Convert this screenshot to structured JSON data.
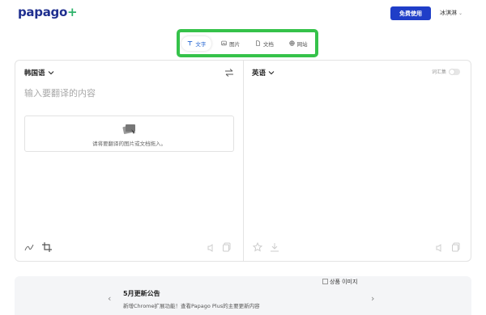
{
  "header": {
    "logo_main": "papago",
    "logo_plus": "+",
    "free_button": "免费使用",
    "user_name": "冰淇淋",
    "user_chevron": "chevron-down-icon"
  },
  "tabs": [
    {
      "label": "文字",
      "icon": "text-icon",
      "active": true
    },
    {
      "label": "图片",
      "icon": "image-icon",
      "active": false
    },
    {
      "label": "文档",
      "icon": "document-icon",
      "active": false
    },
    {
      "label": "网站",
      "icon": "globe-icon",
      "active": false
    }
  ],
  "source": {
    "language": "韩国语",
    "placeholder": "输入要翻译的内容",
    "dropzone_text": "请将要翻译的图片或文档拖入。"
  },
  "target": {
    "language": "英语",
    "glossary_label": "词汇集"
  },
  "banner": {
    "title": "5月更新公告",
    "subtitle": "新增Chrome扩展功能！查看Papago Plus的主要更新内容",
    "image_alt": "상품 이미지"
  },
  "colors": {
    "brand_blue": "#1f3ec8",
    "accent_green": "#35c24a",
    "active_tab": "#2364d2"
  }
}
